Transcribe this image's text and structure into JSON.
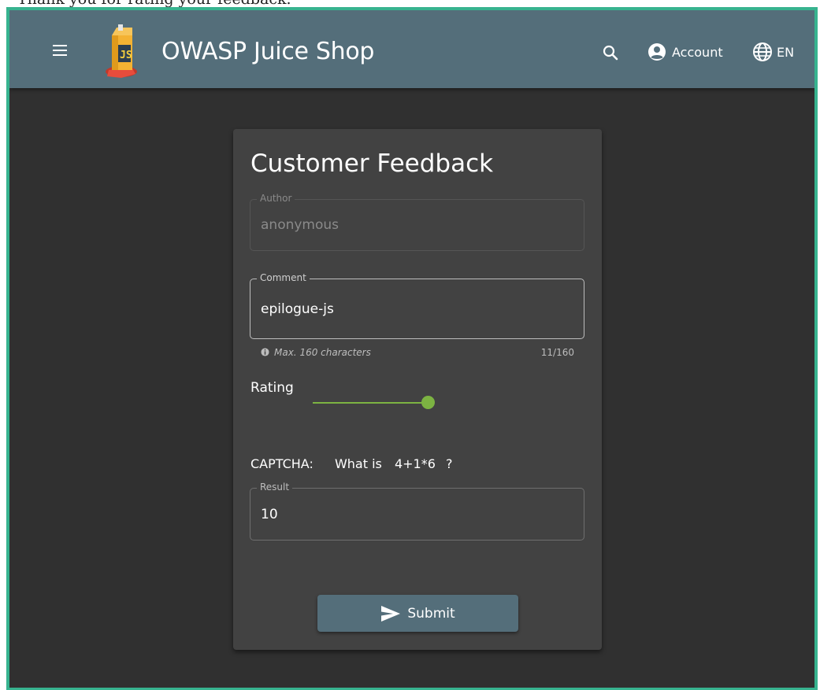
{
  "page_caption": "Thank you for rating your feedback.",
  "toolbar": {
    "app_title": "OWASP Juice Shop",
    "account_label": "Account",
    "language_label": "EN",
    "icons": {
      "menu": "menu-icon",
      "logo": "juice-box-logo",
      "search": "search-icon",
      "account": "account-circle-icon",
      "language": "globe-icon"
    }
  },
  "colors": {
    "toolbar": "#546e7a",
    "background": "#303030",
    "card": "#424242",
    "accent": "#7cb342",
    "frame": "#37b38f"
  },
  "feedback": {
    "title": "Customer Feedback",
    "author": {
      "label": "Author",
      "value": "anonymous"
    },
    "comment": {
      "label": "Comment",
      "value": "epilogue-js",
      "hint": "Max. 160 characters",
      "counter": "11/160"
    },
    "rating": {
      "label": "Rating",
      "value_fraction": 1.0
    },
    "captcha": {
      "label": "CAPTCHA:",
      "question_prefix": "What is",
      "expression": "4+1*6",
      "question_suffix": "?"
    },
    "result": {
      "label": "Result",
      "value": "10"
    },
    "submit_label": "Submit"
  }
}
